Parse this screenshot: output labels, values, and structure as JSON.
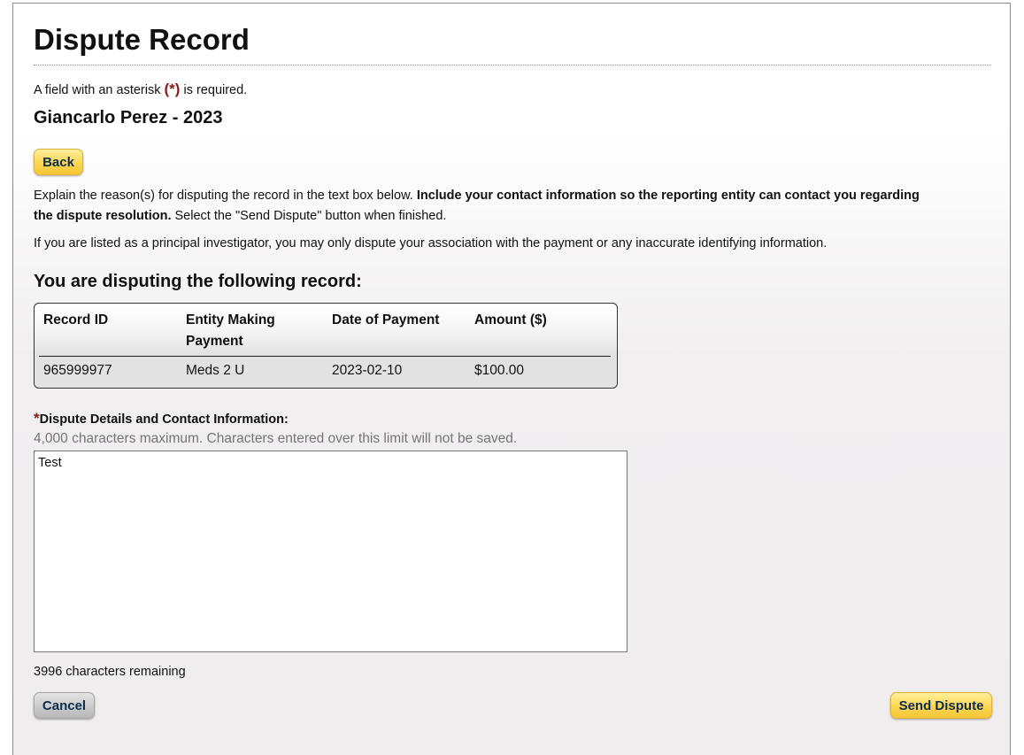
{
  "page": {
    "title": "Dispute Record",
    "required_note": {
      "before": "A field with an asterisk ",
      "asterisk": "(*)",
      "after": " is required."
    },
    "record_owner": "Giancarlo Perez - 2023"
  },
  "buttons": {
    "back": "Back",
    "cancel": "Cancel",
    "send": "Send Dispute"
  },
  "instructions": {
    "part1": "Explain the reason(s) for disputing the record in the text box below. ",
    "part1_bold": "Include your contact information so the reporting entity can contact you regarding the dispute resolution.",
    "part1_end": " Select the \"Send Dispute\" button when finished.",
    "pi_note": "If you are listed as a principal investigator, you may only dispute your association with the payment or any inaccurate identifying information."
  },
  "record_section": {
    "heading": "You are disputing the following record:",
    "columns": [
      "Record ID",
      "Entity Making Payment",
      "Date of Payment",
      "Amount ($)"
    ],
    "row": [
      "965999977",
      "Meds 2 U",
      "2023-02-10",
      "$100.00"
    ]
  },
  "dispute_field": {
    "asterisk": "*",
    "label": "Dispute Details and Contact Information:",
    "hint": "4,000 characters maximum. Characters entered over this limit will not be saved.",
    "value": "Test",
    "remaining": "3996 characters remaining"
  }
}
